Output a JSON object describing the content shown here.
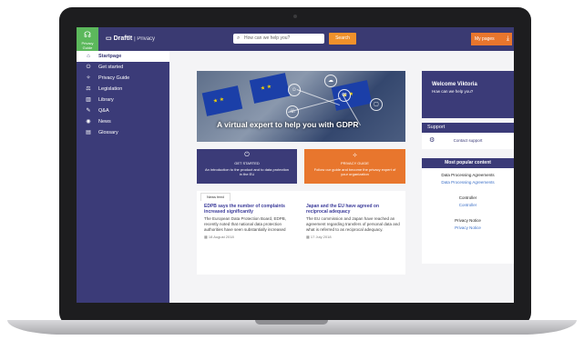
{
  "header": {
    "logo_label": "Privacy Guide",
    "brand": "DraftIt",
    "brand_sub": "| Privacy",
    "search_placeholder": "How can we help you?",
    "search_button": "Search",
    "my_pages_button": "My pages"
  },
  "sidebar": {
    "items": [
      {
        "label": "Startpage",
        "icon": "home-icon",
        "glyph": "⌂"
      },
      {
        "label": "Get started",
        "icon": "power-icon",
        "glyph": "⏻"
      },
      {
        "label": "Privacy Guide",
        "icon": "guide-icon",
        "glyph": "✧"
      },
      {
        "label": "Legislation",
        "icon": "scales-icon",
        "glyph": "⚖"
      },
      {
        "label": "Library",
        "icon": "library-icon",
        "glyph": "▥"
      },
      {
        "label": "Q&A",
        "icon": "qa-icon",
        "glyph": "✎"
      },
      {
        "label": "News",
        "icon": "news-icon",
        "glyph": "◉"
      },
      {
        "label": "Glossary",
        "icon": "glossary-icon",
        "glyph": "▤"
      }
    ]
  },
  "hero": {
    "title": "A virtual expert to help you with GDPR"
  },
  "cards": {
    "get_started": {
      "title": "GET STARTED",
      "description": "An introduction to the product and to data protection in the EU"
    },
    "privacy_guide": {
      "title": "PRIVACY GUIDE",
      "description": "Follow our guide and become the privacy expert of your organization"
    }
  },
  "news": {
    "tab": "News feed",
    "items": [
      {
        "headline": "EDPB says the number of complaints increased significantly",
        "body": "The European Data Protection Board, EDPB, recently noted that national data protection authorities have seen substantially increased",
        "date": "18 August 2018"
      },
      {
        "headline": "Japan and the EU have agreed on reciprocal adequacy",
        "body": "The EU commission and Japan have reached an agreement regarding transfers of personal data and what is referred to as reciprocal adequacy.",
        "date": "17 July 2018"
      }
    ]
  },
  "welcome": {
    "title": "Welcome Viktoria",
    "subtitle": "How can we help you?"
  },
  "support": {
    "title": "Support",
    "link": "Contact support"
  },
  "popular": {
    "title": "Most popular content",
    "items": [
      {
        "title": "Data Processing Agreements",
        "link": "Data Processing Agreements"
      },
      {
        "title": "Controller",
        "link": "Controller"
      },
      {
        "title": "Privacy Notice",
        "link": "Privacy Notice"
      }
    ]
  },
  "colors": {
    "primary": "#3b3b78",
    "accent": "#e8762d",
    "logo_green": "#5cb85c"
  }
}
